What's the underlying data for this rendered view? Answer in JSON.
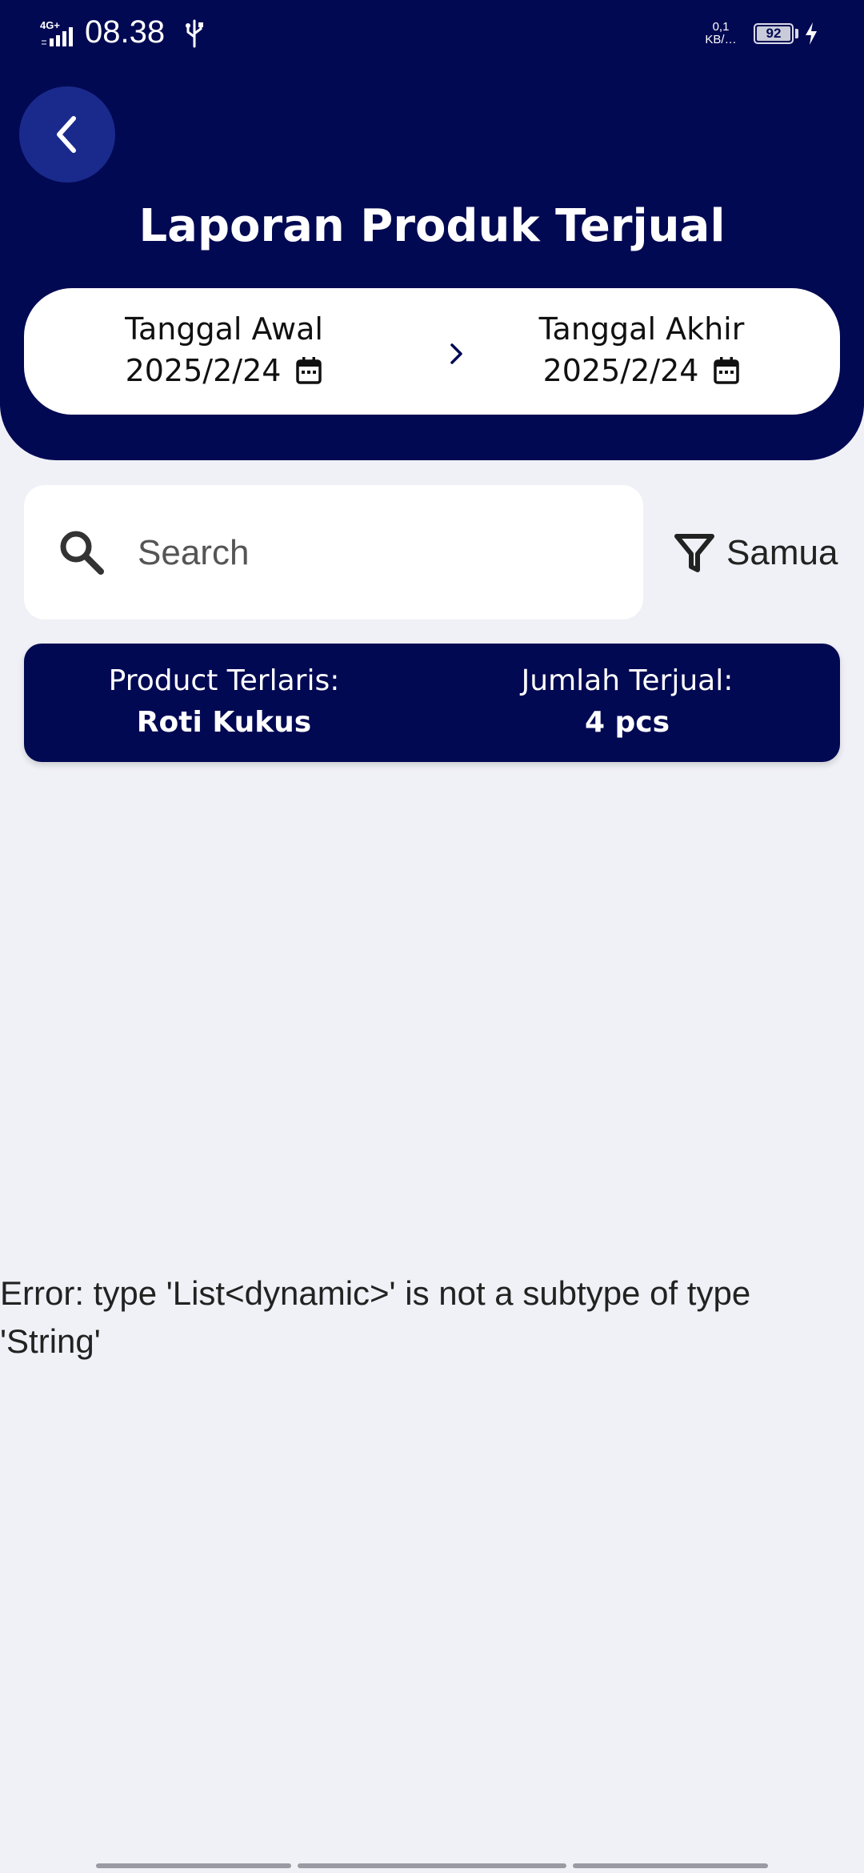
{
  "status_bar": {
    "network": "4G+",
    "time": "08.38",
    "speed_value": "0,1",
    "speed_unit": "KB/…",
    "battery": "92",
    "icons": [
      "signal-icon",
      "usb-icon",
      "battery-icon",
      "charging-icon"
    ]
  },
  "header": {
    "title": "Laporan Produk Terjual",
    "back_icon": "chevron-left-icon",
    "start_date": {
      "label": "Tanggal Awal",
      "value": "2025/2/24"
    },
    "end_date": {
      "label": "Tanggal Akhir",
      "value": "2025/2/24"
    }
  },
  "search": {
    "placeholder": "Search",
    "value": ""
  },
  "filter": {
    "label": "Samua",
    "icon": "filter-icon"
  },
  "summary": {
    "best_label": "Product Terlaris:",
    "best_value": "Roti Kukus",
    "sold_label": "Jumlah Terjual:",
    "sold_value": "4 pcs"
  },
  "error": {
    "message": "Error: type 'List<dynamic>' is not a subtype of type 'String'"
  },
  "colors": {
    "primary": "#020953",
    "back_button": "#1a2a8c",
    "background": "#f0f1f6",
    "card": "#ffffff"
  }
}
